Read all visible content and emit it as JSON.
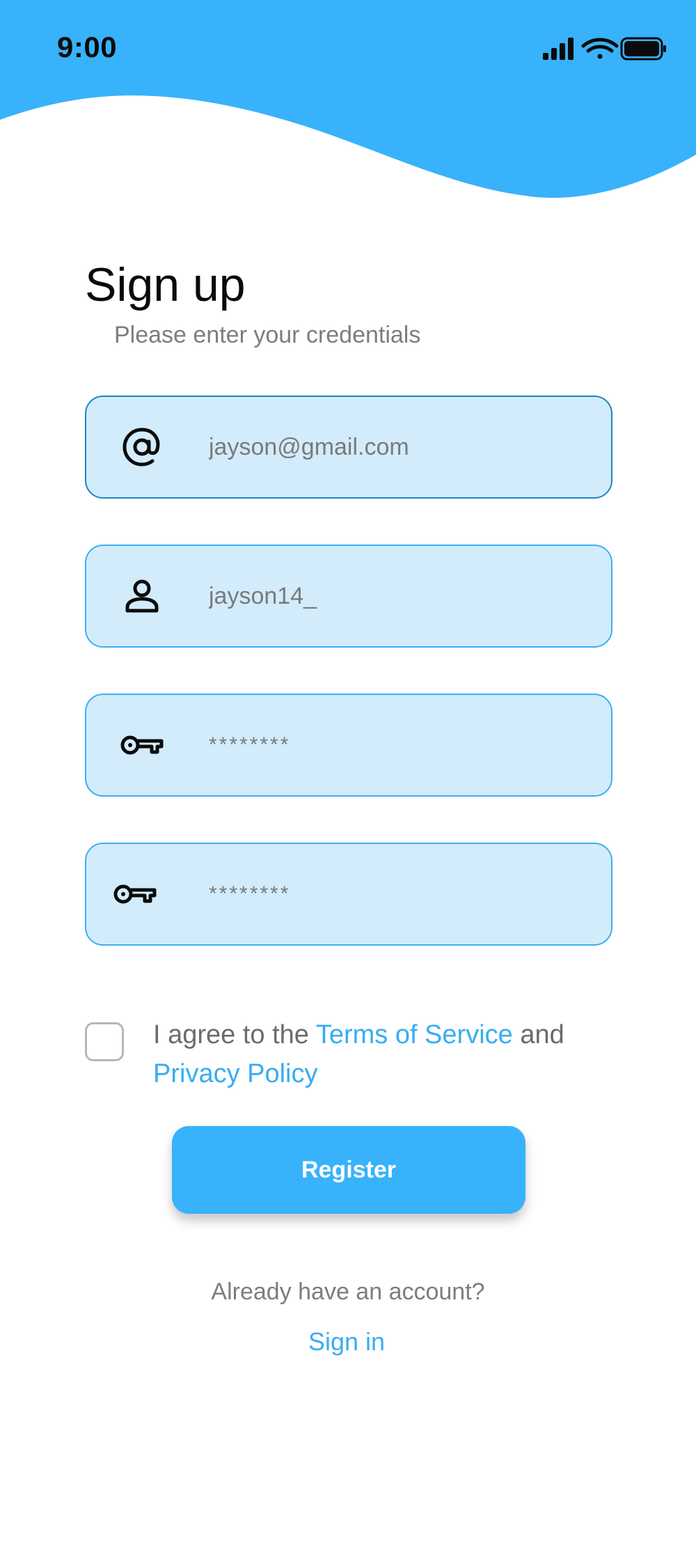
{
  "status_bar": {
    "time": "9:00",
    "icons": [
      "cellular-signal-icon",
      "wifi-icon",
      "battery-icon"
    ]
  },
  "header": {
    "title": "Sign up",
    "subtitle": "Please enter your credentials"
  },
  "form": {
    "email": {
      "icon": "at-sign-icon",
      "value": "jayson@gmail.com"
    },
    "username": {
      "icon": "user-icon",
      "value": "jayson14_"
    },
    "password": {
      "icon": "key-icon",
      "value": "********"
    },
    "confirm_password": {
      "icon": "key-icon",
      "value": "********"
    }
  },
  "terms": {
    "checked": false,
    "prefix": "I agree to the ",
    "terms_link": "Terms of Service",
    "middle": " and ",
    "privacy_link": "Privacy Policy"
  },
  "actions": {
    "register_label": "Register",
    "already_text": "Already have an account?",
    "signin_label": "Sign in"
  },
  "colors": {
    "accent": "#38B2FA",
    "field_bg": "#D2ECFC",
    "field_border": "#3AAFF2",
    "text_muted": "#7D7D7D"
  }
}
